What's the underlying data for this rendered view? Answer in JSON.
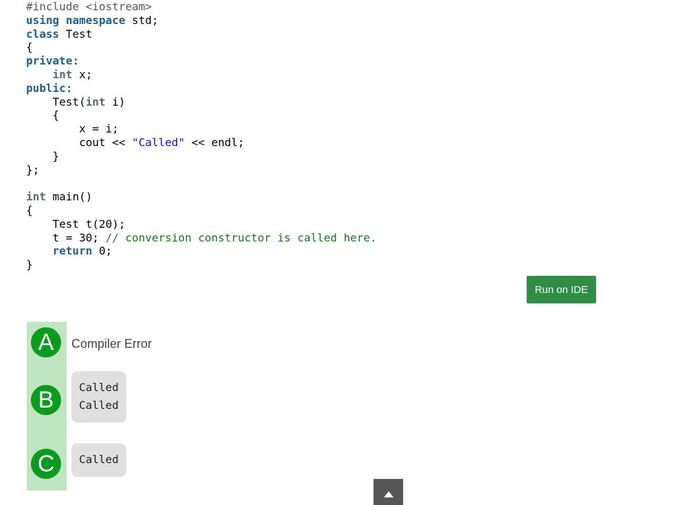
{
  "code": {
    "lines": [
      [
        {
          "t": "#include <iostream>",
          "c": "pp"
        }
      ],
      [
        {
          "t": "using",
          "c": "kw"
        },
        {
          "t": " "
        },
        {
          "t": "namespace",
          "c": "kw"
        },
        {
          "t": " std;"
        }
      ],
      [
        {
          "t": "class",
          "c": "kw"
        },
        {
          "t": " Test"
        }
      ],
      [
        {
          "t": "{"
        }
      ],
      [
        {
          "t": "private",
          "c": "kw"
        },
        {
          "t": ":"
        }
      ],
      [
        {
          "t": "    "
        },
        {
          "t": "int",
          "c": "ty"
        },
        {
          "t": " x;"
        }
      ],
      [
        {
          "t": "public",
          "c": "kw"
        },
        {
          "t": ":"
        }
      ],
      [
        {
          "t": "    Test("
        },
        {
          "t": "int",
          "c": "ty"
        },
        {
          "t": " i)"
        }
      ],
      [
        {
          "t": "    {"
        }
      ],
      [
        {
          "t": "        x = i;"
        }
      ],
      [
        {
          "t": "        cout << "
        },
        {
          "t": "\"Called\"",
          "c": "str"
        },
        {
          "t": " << endl;"
        }
      ],
      [
        {
          "t": "    }"
        }
      ],
      [
        {
          "t": "};"
        }
      ],
      [
        {
          "t": ""
        }
      ],
      [
        {
          "t": "int",
          "c": "ty"
        },
        {
          "t": " main()"
        }
      ],
      [
        {
          "t": "{"
        }
      ],
      [
        {
          "t": "    Test t(20);"
        }
      ],
      [
        {
          "t": "    t = 30; "
        },
        {
          "t": "// conversion constructor is called here.",
          "c": "cm"
        }
      ],
      [
        {
          "t": "    "
        },
        {
          "t": "return",
          "c": "kw"
        },
        {
          "t": " 0;"
        }
      ],
      [
        {
          "t": "}"
        }
      ]
    ]
  },
  "run_button": {
    "label": "Run on IDE"
  },
  "options": [
    {
      "letter": "A",
      "text": "Compiler Error"
    },
    {
      "letter": "B",
      "lines": [
        "Called",
        "Called"
      ]
    },
    {
      "letter": "C",
      "lines": [
        "Called"
      ]
    }
  ],
  "colors": {
    "accent": "#2f8d46",
    "option_circle": "#0a9b1f",
    "option_strip": "#c1e4c2"
  }
}
